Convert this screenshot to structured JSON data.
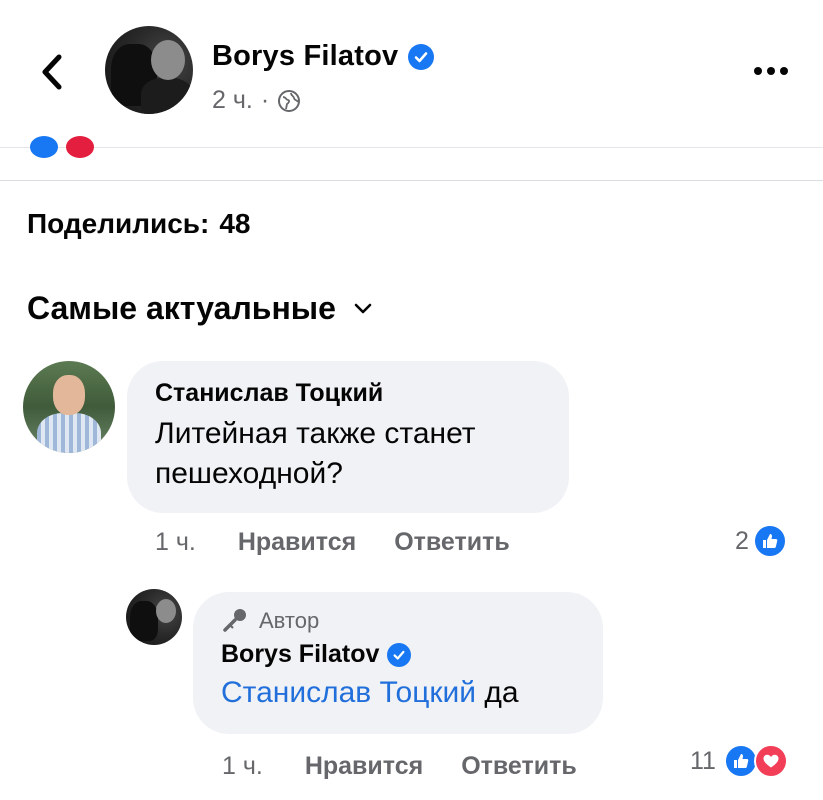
{
  "header": {
    "back_icon": "chevron-left-icon",
    "author_name": "Borys Filatov",
    "time": "2 ч.",
    "separator": "·",
    "privacy_icon": "globe-icon",
    "more_icon": "more-icon"
  },
  "shares": {
    "label": "Поделились:",
    "count": "48"
  },
  "sort": {
    "label": "Самые актуальные"
  },
  "comments": [
    {
      "author": "Станислав Тоцкий",
      "text": "Литейная также станет пешеходной?",
      "time": "1 ч.",
      "like_label": "Нравится",
      "reply_label": "Ответить",
      "reaction_count": "2",
      "reactions": [
        "like"
      ]
    },
    {
      "badge": "Автор",
      "author": "Borys Filatov",
      "mention": "Станислав Тоцкий",
      "text": "да",
      "time": "1 ч.",
      "like_label": "Нравится",
      "reply_label": "Ответить",
      "reaction_count": "11",
      "reactions": [
        "like",
        "love"
      ]
    }
  ],
  "colors": {
    "accent": "#1877f2",
    "love": "#f33e58",
    "mention": "#216fdb",
    "bubble": "#f0f2f5",
    "secondary_text": "#65676b"
  }
}
